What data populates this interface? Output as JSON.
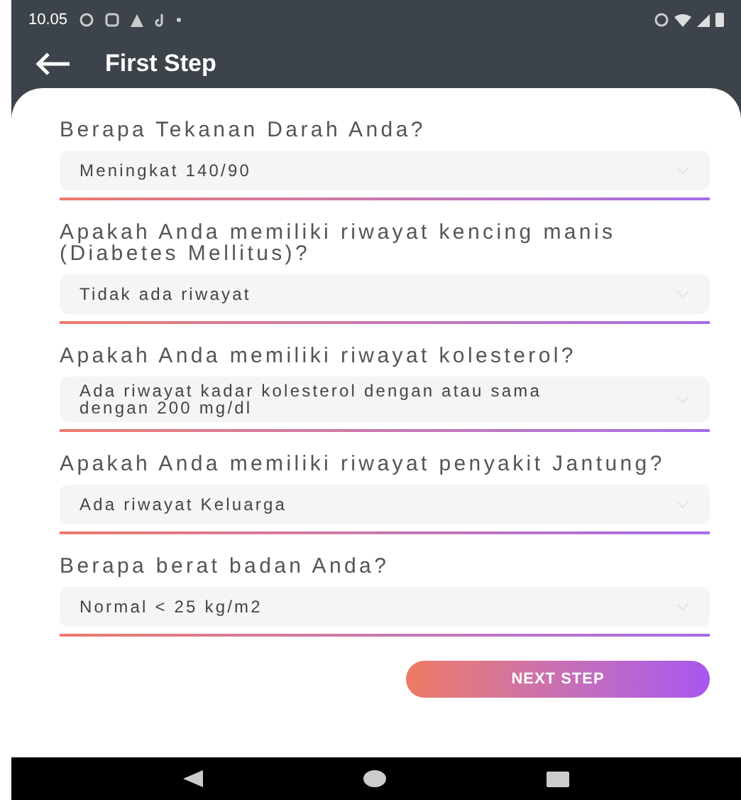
{
  "status_bar": {
    "time": "10.05"
  },
  "header": {
    "title": "First Step"
  },
  "questions": [
    {
      "label": "Berapa Tekanan Darah Anda?",
      "value": "Meningkat 140/90"
    },
    {
      "label": "Apakah Anda memiliki riwayat kencing manis (Diabetes Mellitus)?",
      "value": "Tidak ada riwayat"
    },
    {
      "label": "Apakah Anda memiliki riwayat kolesterol?",
      "value": "Ada riwayat kadar kolesterol dengan atau sama dengan 200 mg/dl"
    },
    {
      "label": "Apakah Anda memiliki riwayat penyakit Jantung?",
      "value": "Ada riwayat Keluarga"
    },
    {
      "label": "Berapa berat badan Anda?",
      "value": "Normal < 25 kg/m2"
    }
  ],
  "next_button": {
    "label": "NEXT STEP"
  }
}
